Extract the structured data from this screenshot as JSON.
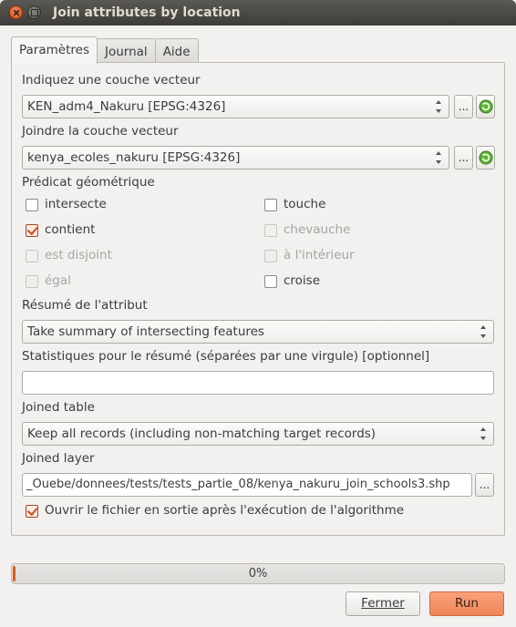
{
  "window": {
    "title": "Join attributes by location"
  },
  "tabs": [
    {
      "label": "Paramètres",
      "active": true
    },
    {
      "label": "Journal",
      "active": false
    },
    {
      "label": "Aide",
      "active": false
    }
  ],
  "form": {
    "input_layer_label": "Indiquez une couche vecteur",
    "input_layer_value": "KEN_adm4_Nakuru [EPSG:4326]",
    "join_layer_label": "Joindre la couche vecteur",
    "join_layer_value": "kenya_ecoles_nakuru [EPSG:4326]",
    "browse_label": "...",
    "predicate_label": "Prédicat géométrique",
    "predicates": [
      {
        "label": "intersecte",
        "checked": false,
        "enabled": true
      },
      {
        "label": "touche",
        "checked": false,
        "enabled": true
      },
      {
        "label": "contient",
        "checked": true,
        "enabled": true
      },
      {
        "label": "chevauche",
        "checked": false,
        "enabled": false
      },
      {
        "label": "est disjoint",
        "checked": false,
        "enabled": false
      },
      {
        "label": "à l'intérieur",
        "checked": false,
        "enabled": false
      },
      {
        "label": "égal",
        "checked": false,
        "enabled": false
      },
      {
        "label": "croise",
        "checked": false,
        "enabled": true
      }
    ],
    "summary_label": "Résumé de l'attribut",
    "summary_value": "Take summary of intersecting features",
    "stats_label": "Statistiques pour le résumé (séparées par une virgule) [optionnel]",
    "stats_value": "",
    "joined_table_label": "Joined table",
    "joined_table_value": "Keep all records (including non-matching target records)",
    "joined_layer_label": "Joined layer",
    "joined_layer_value": "_Ouebe/donnees/tests/tests_partie_08/kenya_nakuru_join_schools3.shp",
    "open_output_label": "Ouvrir le fichier en sortie après l'exécution de l'algorithme",
    "open_output_checked": true
  },
  "progress": {
    "value": 0,
    "label": "0%"
  },
  "buttons": {
    "cancel_label": "Fermer",
    "run_label": "Run"
  },
  "colors": {
    "accent": "#e2591c",
    "run_button": "#f08656",
    "titlebar": "#3d3c38"
  }
}
